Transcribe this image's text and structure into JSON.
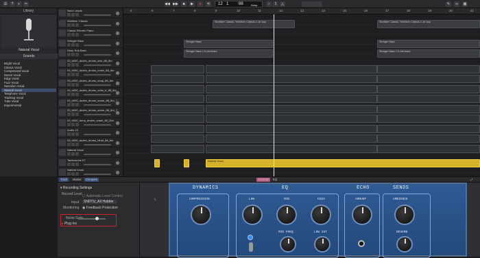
{
  "transport": {
    "lcd_bar": "12",
    "lcd_beat": "1",
    "lcd_tempo": "88",
    "lcd_tempo_label": "Keep"
  },
  "library": {
    "title": "Library",
    "patch_name": "Natural Vocal",
    "category": "Sounds",
    "presets": [
      "Bright Vocal",
      "Classic Vocal",
      "Compressed Vocal",
      "Dance Vocal",
      "Edgy Vocal",
      "Fuzz Vocal",
      "Narration Vocal",
      "Natural Vocal",
      "Telephone Vocal",
      "Tracking Vocal",
      "Tube Vocal",
      "Experimental"
    ],
    "selected_preset": "Natural Vocal"
  },
  "tracks": [
    "Neue Leads",
    "Wurlitzer Classic",
    "Classic Electric Piano",
    "Stringer Bass",
    "Deep Sub Bass",
    "03_b000_dudes_drums_kick_88_8m",
    "03_b000_dudes_drums_crash_88_8m",
    "03_b000_dudes_drums_snap_88_8m",
    "03_b000_dudes_drums_ohhs_b_88_8m",
    "03_b000_dudes_drums_snare_88_8m_1",
    "03_b000_dudes_drums_snare_88_8m_2",
    "03_b000_berry_drums_crash_80_2bn",
    "Audio 15",
    "03_b000_dudes_drums_hihat_88_8m",
    "Natural Vocal",
    "Tambourine 07",
    "Natural Vocal"
  ],
  "ruler": [
    "5",
    "6",
    "7",
    "8",
    "9",
    "10",
    "11",
    "12",
    "13",
    "14",
    "15",
    "16",
    "17",
    "18",
    "19",
    "20",
    "21"
  ],
  "regions": {
    "wurlitzer": "Wurlitzer Classic: Wurlitzer Classic-4.1e loop",
    "bass1": "Stringer Bass",
    "bass2": "Stringer Bass.1.5 reentrant",
    "bass3": "Stringer Bass",
    "bass4": "Stringer Bass.1.5 reentrant",
    "vocal": "Natural Vocal"
  },
  "bottom_tabs": [
    "Track",
    "Master",
    "Compare"
  ],
  "plugin_tabs": [
    "Controls",
    "EQ"
  ],
  "recording": {
    "header": "Recording Settings",
    "record_level_label": "Record Level",
    "record_level_value": "Automatic Level Control",
    "input_label": "Input",
    "input_value": "SNDTU_A3 Hubble",
    "monitoring_label": "Monitoring",
    "monitoring_value": "Feedback Protection",
    "noise_gate_label": "Noise Gate",
    "plugins_label": "Plug-ins"
  },
  "plugin": {
    "sections": {
      "dynamics": "DYNAMICS",
      "eq": "EQ",
      "echo": "ECHO",
      "sends": "SENDS"
    },
    "knobs": {
      "compression": "COMPRESSION",
      "low": "LOW",
      "mid": "MID",
      "high": "HIGH",
      "mid_freq": "MID FREQ",
      "low_cut": "LOW CUT",
      "amount": "AMOUNT",
      "ambience": "AMBIENCE",
      "reverb": "REVERB"
    }
  },
  "colors": {
    "accent_region": "#d6b22a",
    "plugin_blue": "#2f5a93",
    "highlight_red": "#c9232f",
    "recording_pink": "#b25a80"
  }
}
